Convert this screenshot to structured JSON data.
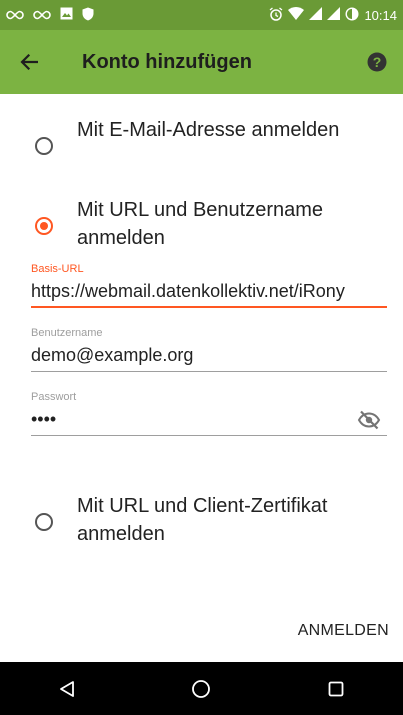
{
  "status_bar": {
    "time": "10:14",
    "icons": [
      "infinity-icon",
      "infinity-icon",
      "image-icon",
      "shield-icon",
      "alarm-icon",
      "wifi-icon",
      "signal-icon",
      "signal-icon",
      "battery-icon"
    ]
  },
  "toolbar": {
    "title": "Konto hinzufügen",
    "back_icon": "arrow-back-icon",
    "help_icon": "help-icon",
    "background": "#7cb342",
    "status_background": "#6a9a36"
  },
  "options": {
    "email": {
      "label": "Mit E-Mail-Adresse anmelden",
      "checked": false
    },
    "url_user": {
      "label": "Mit URL und Benutzername anmelden",
      "checked": true
    },
    "url_cert": {
      "label": "Mit URL und Client-Zertifikat anmelden",
      "checked": false
    }
  },
  "fields": {
    "base_url": {
      "label": "Basis-URL",
      "value": "https://webmail.datenkollektiv.net/iRony"
    },
    "username": {
      "label": "Benutzername",
      "value": "demo@example.org"
    },
    "password": {
      "label": "Passwort",
      "value": "demo"
    }
  },
  "actions": {
    "anmelden": "ANMELDEN"
  },
  "accent_color": "#ff5722",
  "nav": [
    "back-triangle-icon",
    "home-circle-icon",
    "recents-square-icon"
  ]
}
